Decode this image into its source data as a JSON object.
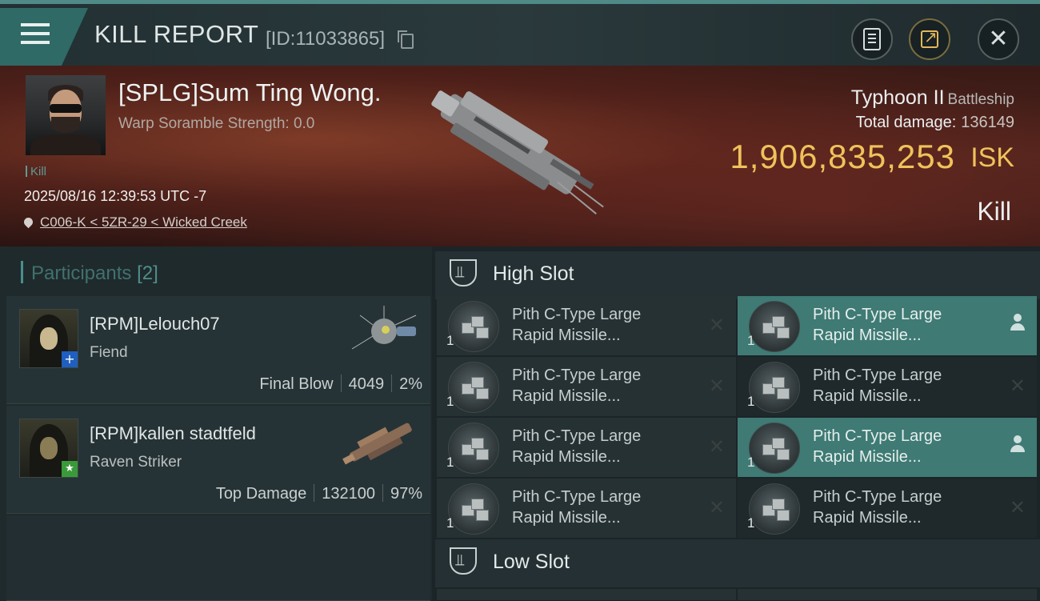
{
  "header": {
    "title": "KILL REPORT",
    "report_id": "[ID:11033865]",
    "icons": {
      "menu": "hamburger-menu-icon",
      "copy": "copy-icon",
      "clipboard": "clipboard-icon",
      "share": "share-icon",
      "close": "close-icon"
    },
    "colors": {
      "accent": "#2f6a66",
      "gold": "#f0c25b"
    }
  },
  "victim": {
    "name": "[SPLG]Sum Ting Wong.",
    "scramble": "Warp Soramble Strength: 0.0",
    "tag": "Kill",
    "timestamp": "2025/08/16 12:39:53 UTC -7",
    "location": "C006-K < 5ZR-29 < Wicked Creek",
    "ship_name": "Typhoon II",
    "ship_class": "Battleship",
    "total_damage_label": "Total damage:",
    "total_damage": "136149",
    "isk_value": "1,906,835,253",
    "isk_unit": "ISK",
    "result": "Kill"
  },
  "participants": {
    "label": "Participants",
    "count": "[2]",
    "list": [
      {
        "name": "[RPM]Lelouch07",
        "ship": "Fiend",
        "role": "Final Blow",
        "damage": "4049",
        "percent": "2%",
        "badge": "+"
      },
      {
        "name": "[RPM]kallen stadtfeld",
        "ship": "Raven Striker",
        "role": "Top Damage",
        "damage": "132100",
        "percent": "97%",
        "badge": "★"
      }
    ]
  },
  "fitting": {
    "high_slot_label": "High Slot",
    "low_slot_label": "Low Slot",
    "high_modules": [
      {
        "qty": "1",
        "line1": "Pith C-Type Large",
        "line2": "Rapid Missile...",
        "status": "destroyed"
      },
      {
        "qty": "1",
        "line1": "Pith C-Type Large",
        "line2": "Rapid Missile...",
        "status": "dropped"
      },
      {
        "qty": "1",
        "line1": "Pith C-Type Large",
        "line2": "Rapid Missile...",
        "status": "destroyed"
      },
      {
        "qty": "1",
        "line1": "Pith C-Type Large",
        "line2": "Rapid Missile...",
        "status": "destroyed"
      },
      {
        "qty": "1",
        "line1": "Pith C-Type Large",
        "line2": "Rapid Missile...",
        "status": "destroyed"
      },
      {
        "qty": "1",
        "line1": "Pith C-Type Large",
        "line2": "Rapid Missile...",
        "status": "dropped"
      },
      {
        "qty": "1",
        "line1": "Pith C-Type Large",
        "line2": "Rapid Missile...",
        "status": "destroyed"
      },
      {
        "qty": "1",
        "line1": "Pith C-Type Large",
        "line2": "Rapid Missile...",
        "status": "destroyed"
      }
    ]
  }
}
